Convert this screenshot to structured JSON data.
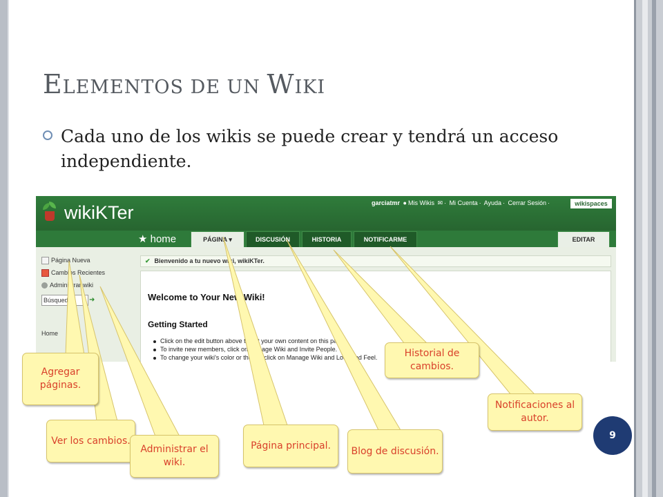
{
  "slide": {
    "title_first_letter_1": "E",
    "title_rest_1": "LEMENTOS DE UN ",
    "title_first_letter_2": "W",
    "title_rest_2": "IKI",
    "bullet": "Cada uno de los wikis se puede crear y tendrá un acceso independiente.",
    "page_number": "9"
  },
  "wiki": {
    "name": "wikiKTer",
    "userbar": {
      "username": "garciatmr",
      "my_wikis": "Mis Wikis",
      "my_account": "Mi Cuenta",
      "help": "Ayuda",
      "logout": "Cerrar Sesión",
      "brand": "wikispaces"
    },
    "home_label": "★ home",
    "tabs": [
      {
        "label": "PÁGINA ▾"
      },
      {
        "label": "DISCUSIÓN"
      },
      {
        "label": "HISTORIA"
      },
      {
        "label": "NOTIFICARME"
      }
    ],
    "edit_tab": "EDITAR",
    "sidebar": {
      "new_page": "Página Nueva",
      "recent_changes": "Cambios Recientes",
      "manage_wiki": "Administrar wiki",
      "search_value": "Búsqued",
      "home": "Home"
    },
    "welcome_message": "Bienvenido a tu nuevo wiki, wikiKTer.",
    "page": {
      "heading": "Welcome to Your New Wiki!",
      "subheading": "Getting Started",
      "lines": [
        "Click on the edit button above to put your own content on this page.",
        "To invite new members, click on Manage Wiki and Invite People.",
        "To change your wiki's color or theme, click on Manage Wiki and Look and Feel."
      ]
    }
  },
  "callouts": {
    "agregar": "Agregar páginas.",
    "ver": "Ver los cambios.",
    "administrar": "Administrar el wiki.",
    "pagina": "Página principal.",
    "blog": "Blog de discusión.",
    "historial": "Historial de cambios.",
    "notificaciones": "Notificaciones al autor."
  },
  "colors": {
    "wiki_green": "#2f7c3b",
    "callout_fill": "#fff8b0",
    "callout_text": "#d9412b",
    "page_num_bg": "#1f3b73"
  }
}
